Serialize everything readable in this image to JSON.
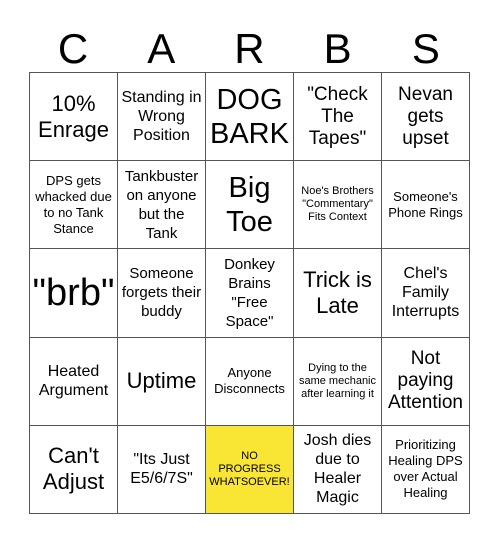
{
  "title_letters": [
    "C",
    "A",
    "R",
    "B",
    "S"
  ],
  "free_color": "#f9e534",
  "cells": [
    {
      "text": "10% Enrage",
      "size": "l"
    },
    {
      "text": "Standing in Wrong Position",
      "size": "s"
    },
    {
      "text": "DOG BARK",
      "size": "xl"
    },
    {
      "text": "\"Check The Tapes\"",
      "size": "m"
    },
    {
      "text": "Nevan gets upset",
      "size": "m"
    },
    {
      "text": "DPS gets whacked due to no Tank Stance",
      "size": "xs"
    },
    {
      "text": "Tankbuster on anyone but the Tank",
      "size": "xs2"
    },
    {
      "text": "Big Toe",
      "size": "xl"
    },
    {
      "text": "Noe's Brothers \"Commentary\" Fits Context",
      "size": "xxs"
    },
    {
      "text": "Someone's Phone Rings",
      "size": "xs"
    },
    {
      "text": "\"brb\"",
      "size": "brb"
    },
    {
      "text": "Someone forgets their buddy",
      "size": "xs2"
    },
    {
      "text": "Donkey Brains \"Free Space\"",
      "size": "xs2"
    },
    {
      "text": "Trick is Late",
      "size": "l"
    },
    {
      "text": "Chel's Family Interrupts",
      "size": "s"
    },
    {
      "text": "Heated Argument",
      "size": "s"
    },
    {
      "text": "Uptime",
      "size": "l"
    },
    {
      "text": "Anyone Disconnects",
      "size": "xs"
    },
    {
      "text": "Dying to the same mechanic after learning it",
      "size": "xxs"
    },
    {
      "text": "Not paying Attention",
      "size": "m"
    },
    {
      "text": "Can't Adjust",
      "size": "l"
    },
    {
      "text": "\"Its Just E5/6/7S\"",
      "size": "s"
    },
    {
      "text": "NO PROGRESS WHATSOEVER!",
      "size": "free",
      "free": true
    },
    {
      "text": "Josh dies due to Healer Magic",
      "size": "s"
    },
    {
      "text": "Prioritizing Healing DPS over Actual Healing",
      "size": "xs"
    }
  ]
}
